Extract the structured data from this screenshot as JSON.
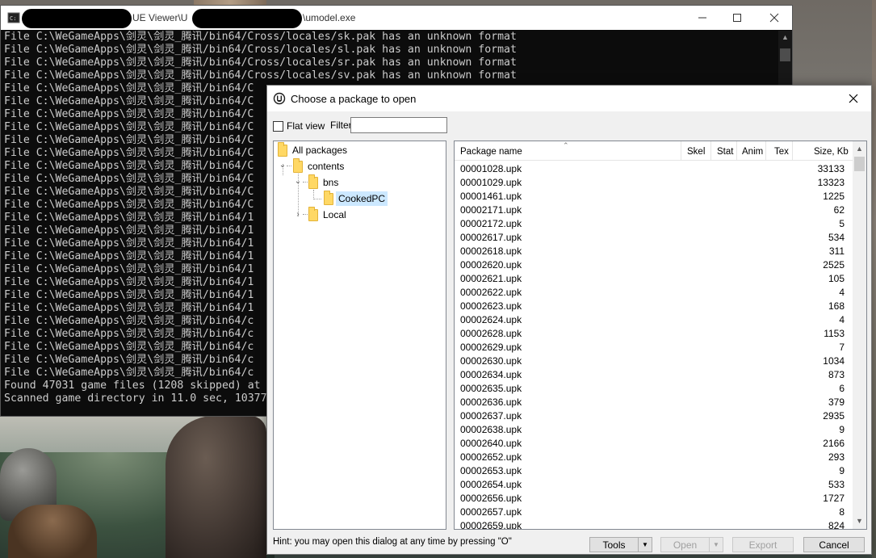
{
  "console": {
    "title_suffix": "UE Viewer\\U",
    "title_tail": "\\umodel.exe",
    "lines": [
      "File C:\\WeGameApps\\剑灵\\剑灵_腾讯/bin64/Cross/locales/sk.pak has an unknown format",
      "File C:\\WeGameApps\\剑灵\\剑灵_腾讯/bin64/Cross/locales/sl.pak has an unknown format",
      "File C:\\WeGameApps\\剑灵\\剑灵_腾讯/bin64/Cross/locales/sr.pak has an unknown format",
      "File C:\\WeGameApps\\剑灵\\剑灵_腾讯/bin64/Cross/locales/sv.pak has an unknown format",
      "File C:\\WeGameApps\\剑灵\\剑灵_腾讯/bin64/C",
      "File C:\\WeGameApps\\剑灵\\剑灵_腾讯/bin64/C",
      "File C:\\WeGameApps\\剑灵\\剑灵_腾讯/bin64/C",
      "File C:\\WeGameApps\\剑灵\\剑灵_腾讯/bin64/C",
      "File C:\\WeGameApps\\剑灵\\剑灵_腾讯/bin64/C",
      "File C:\\WeGameApps\\剑灵\\剑灵_腾讯/bin64/C",
      "File C:\\WeGameApps\\剑灵\\剑灵_腾讯/bin64/C",
      "File C:\\WeGameApps\\剑灵\\剑灵_腾讯/bin64/C",
      "File C:\\WeGameApps\\剑灵\\剑灵_腾讯/bin64/C",
      "File C:\\WeGameApps\\剑灵\\剑灵_腾讯/bin64/C",
      "File C:\\WeGameApps\\剑灵\\剑灵_腾讯/bin64/1",
      "File C:\\WeGameApps\\剑灵\\剑灵_腾讯/bin64/1",
      "File C:\\WeGameApps\\剑灵\\剑灵_腾讯/bin64/1",
      "File C:\\WeGameApps\\剑灵\\剑灵_腾讯/bin64/1",
      "File C:\\WeGameApps\\剑灵\\剑灵_腾讯/bin64/1",
      "File C:\\WeGameApps\\剑灵\\剑灵_腾讯/bin64/1",
      "File C:\\WeGameApps\\剑灵\\剑灵_腾讯/bin64/1",
      "File C:\\WeGameApps\\剑灵\\剑灵_腾讯/bin64/1",
      "File C:\\WeGameApps\\剑灵\\剑灵_腾讯/bin64/c",
      "File C:\\WeGameApps\\剑灵\\剑灵_腾讯/bin64/c",
      "File C:\\WeGameApps\\剑灵\\剑灵_腾讯/bin64/c",
      "File C:\\WeGameApps\\剑灵\\剑灵_腾讯/bin64/c",
      "File C:\\WeGameApps\\剑灵\\剑灵_腾讯/bin64/c",
      "Found 47031 game files (1208 skipped) at",
      "Scanned game directory in 11.0 sec, 10377"
    ]
  },
  "dialog": {
    "title": "Choose a package to open",
    "flat_view_label": "Flat view",
    "filter_label": "Filter:",
    "filter_value": "",
    "tree": {
      "root": "All packages",
      "contents": "contents",
      "bns": "bns",
      "cooked": "CookedPC",
      "local": "Local"
    },
    "columns": {
      "name": "Package name",
      "skel": "Skel",
      "stat": "Stat",
      "anim": "Anim",
      "tex": "Tex",
      "size": "Size, Kb"
    },
    "rows": [
      {
        "name": "00001028.upk",
        "size": "33133"
      },
      {
        "name": "00001029.upk",
        "size": "13323"
      },
      {
        "name": "00001461.upk",
        "size": "1225"
      },
      {
        "name": "00002171.upk",
        "size": "62"
      },
      {
        "name": "00002172.upk",
        "size": "5"
      },
      {
        "name": "00002617.upk",
        "size": "534"
      },
      {
        "name": "00002618.upk",
        "size": "311"
      },
      {
        "name": "00002620.upk",
        "size": "2525"
      },
      {
        "name": "00002621.upk",
        "size": "105"
      },
      {
        "name": "00002622.upk",
        "size": "4"
      },
      {
        "name": "00002623.upk",
        "size": "168"
      },
      {
        "name": "00002624.upk",
        "size": "4"
      },
      {
        "name": "00002628.upk",
        "size": "1153"
      },
      {
        "name": "00002629.upk",
        "size": "7"
      },
      {
        "name": "00002630.upk",
        "size": "1034"
      },
      {
        "name": "00002634.upk",
        "size": "873"
      },
      {
        "name": "00002635.upk",
        "size": "6"
      },
      {
        "name": "00002636.upk",
        "size": "379"
      },
      {
        "name": "00002637.upk",
        "size": "2935"
      },
      {
        "name": "00002638.upk",
        "size": "9"
      },
      {
        "name": "00002640.upk",
        "size": "2166"
      },
      {
        "name": "00002652.upk",
        "size": "293"
      },
      {
        "name": "00002653.upk",
        "size": "9"
      },
      {
        "name": "00002654.upk",
        "size": "533"
      },
      {
        "name": "00002656.upk",
        "size": "1727"
      },
      {
        "name": "00002657.upk",
        "size": "8"
      },
      {
        "name": "00002659.upk",
        "size": "824"
      }
    ],
    "hint": "Hint: you may open this dialog at any time by pressing \"O\"",
    "buttons": {
      "tools": "Tools",
      "open": "Open",
      "export": "Export",
      "cancel": "Cancel"
    }
  }
}
